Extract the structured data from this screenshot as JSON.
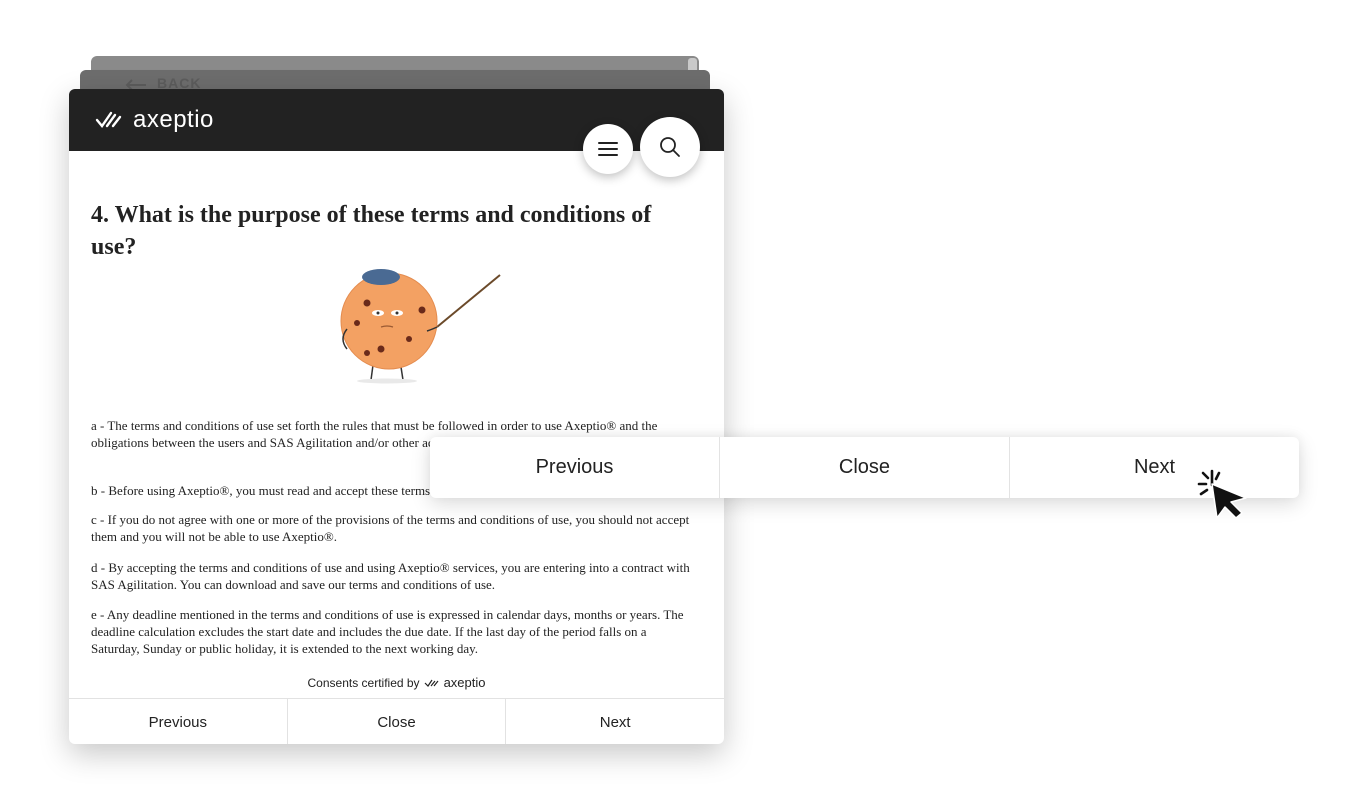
{
  "background_stack": {
    "back_label": "BACK"
  },
  "header": {
    "logo_text": "axeptio",
    "menu_icon": "hamburger-menu-icon",
    "search_icon": "search-icon",
    "bg_color": "#222222"
  },
  "content": {
    "heading": "4. What is the purpose of these terms and conditions of use?",
    "illustration": "cookie-mascot-with-pointer",
    "paragraphs": [
      "a - The terms and conditions of use set forth the rules that must be followed in order to use Axeptio® and the obligations between the users and SAS Agilitation and/or other actors on the country in which the user is located.",
      "b - Before using Axeptio®, you must read and accept these terms and conditions of use.",
      "c - If you do not agree with one or more of the provisions of the terms and conditions of use, you should not accept them and you will not be able to use Axeptio®.",
      "d - By accepting the terms and conditions of use and using Axeptio® services, you are entering into a contract with SAS Agilitation. You can download and save our terms and conditions of use.",
      "e - Any deadline mentioned in the terms and conditions of use is expressed in calendar days, months or years. The deadline calculation excludes the start date and includes the due date. If the last day of the period falls on a Saturday, Sunday or public holiday, it is extended to the next working day."
    ],
    "consents_label": "Consents certified by",
    "consents_brand": "axeptio"
  },
  "footer": {
    "previous_label": "Previous",
    "close_label": "Close",
    "next_label": "Next"
  },
  "floating_bar": {
    "previous_label": "Previous",
    "close_label": "Close",
    "next_label": "Next"
  },
  "cursor_icon": "click-pointer-cursor-icon"
}
